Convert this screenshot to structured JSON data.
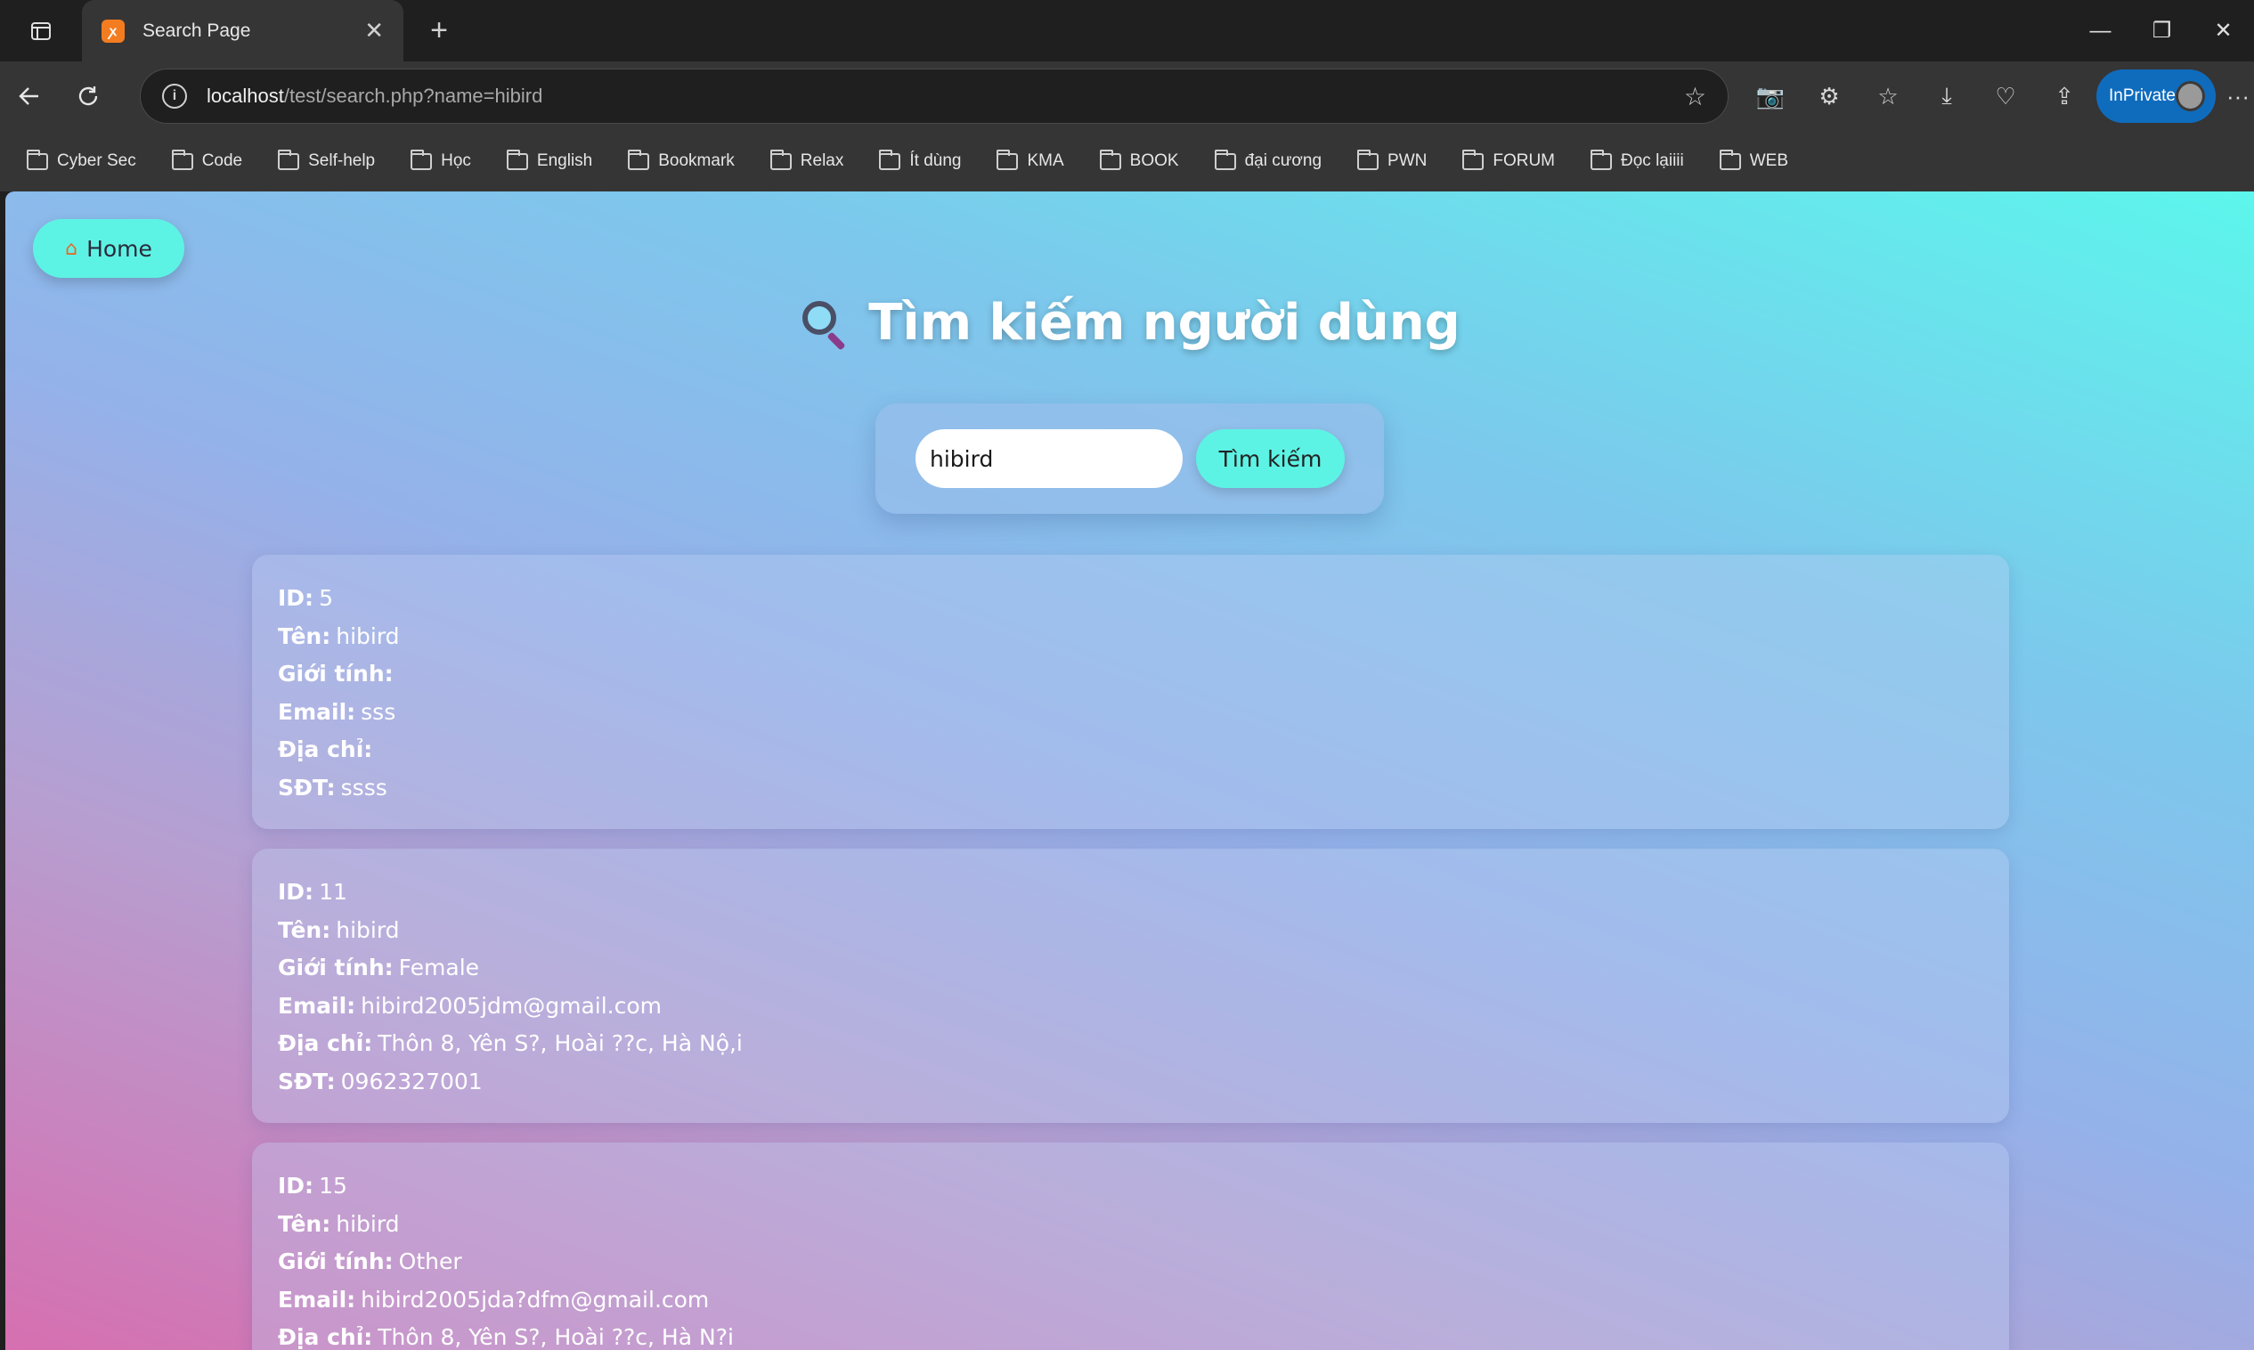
{
  "browser": {
    "tab_title": "Search Page",
    "url_host": "localhost",
    "url_path": "/test/search.php?name=hibird",
    "inprivate_label": "InPrivate",
    "bookmarks": [
      "Cyber Sec",
      "Code",
      "Self-help",
      "Học",
      "English",
      "Bookmark",
      "Relax",
      "Ít dùng",
      "KMA",
      "BOOK",
      "đại cương",
      "PWN",
      "FORUM",
      "Đọc lạiiii",
      "WEB"
    ]
  },
  "page": {
    "home_label": "Home",
    "heading": "Tìm kiếm người dùng",
    "search_value": "hibird",
    "search_button": "Tìm kiếm"
  },
  "labels": {
    "id": "ID:",
    "name": "Tên:",
    "gender": "Giới tính:",
    "email": "Email:",
    "address": "Địa chỉ:",
    "phone": "SĐT:"
  },
  "results": [
    {
      "id": "5",
      "name": "hibird",
      "gender": "",
      "email": "sss",
      "address": "",
      "phone": "ssss"
    },
    {
      "id": "11",
      "name": "hibird",
      "gender": "Female",
      "email": "hibird2005jdm@gmail.com",
      "address": "Thôn 8, Yên S?, Hoài ??c, Hà Nộ,i",
      "phone": "0962327001"
    },
    {
      "id": "15",
      "name": "hibird",
      "gender": "Other",
      "email": "hibird2005jda?dfm@gmail.com",
      "address": "Thôn 8, Yên S?, Hoài ??c, Hà N?i",
      "phone": ""
    }
  ]
}
